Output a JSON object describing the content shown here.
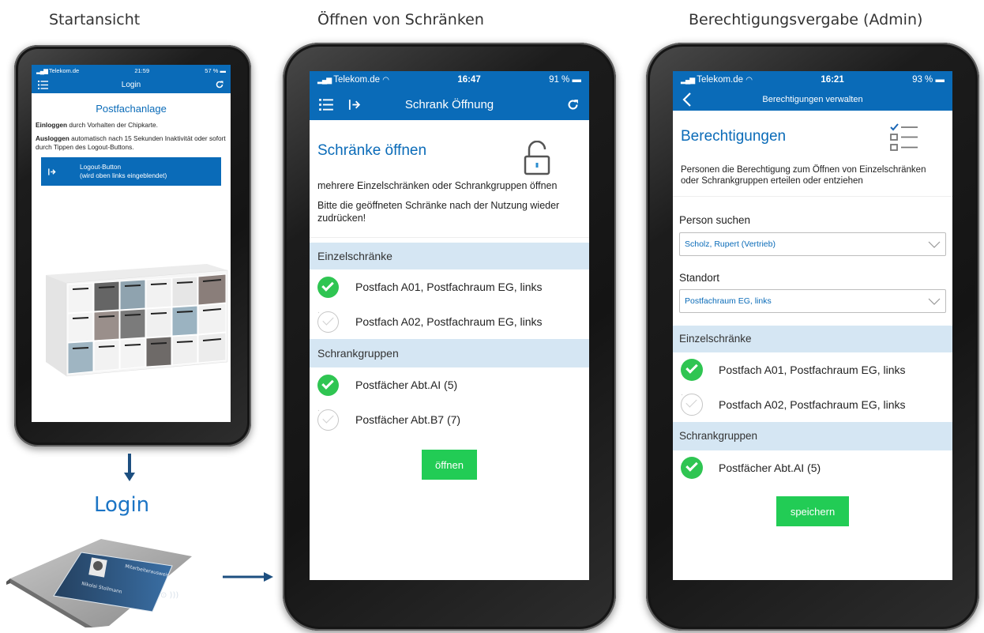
{
  "captions": {
    "start": "Startansicht",
    "open": "Öffnen von Schränken",
    "admin": "Berechtigungsvergabe (Admin)",
    "login": "Login"
  },
  "colors": {
    "brand_blue": "#0a6bb8",
    "section_bg": "#d5e6f3",
    "check_green": "#2fc552",
    "button_green": "#22cc55"
  },
  "screen1": {
    "status": {
      "carrier": "Telekom.de",
      "time": "21:59",
      "battery": "57 %"
    },
    "nav": {
      "title": "Login",
      "left_icon": "list-icon",
      "right_icon": "refresh-icon"
    },
    "heading": "Postfachanlage",
    "login_bold": "Einloggen",
    "login_text": " durch Vorhalten der Chipkarte.",
    "logout_bold": "Ausloggen",
    "logout_text": " automatisch nach 15 Sekunden Inaktivität oder sofort durch Tippen des Logout-Buttons.",
    "logout_button": {
      "line1": "Logout-Button",
      "line2": "(wird oben links eingeblendet)",
      "icon": "logout-icon"
    }
  },
  "card_reader": {
    "card_name": "Nikolai Stollmann",
    "card_brand": "Mitarbeiterausweis"
  },
  "screen2": {
    "status": {
      "carrier": "Telekom.de",
      "time": "16:47",
      "battery": "91 %"
    },
    "nav": {
      "title": "Schrank Öffnung",
      "left_icons": [
        "list-icon",
        "logout-icon"
      ],
      "right_icon": "refresh-icon"
    },
    "heading": "Schränke öffnen",
    "heading_icon": "unlock-icon",
    "text1": "mehrere Einzelschränken oder Schrankgruppen öffnen",
    "text2": "Bitte die geöffneten Schränke nach der Nutzung wieder zudrücken!",
    "sections": [
      {
        "header": "Einzelschränke",
        "items": [
          {
            "label": "Postfach A01, Postfachraum EG, links",
            "checked": true
          },
          {
            "label": "Postfach A02, Postfachraum EG, links",
            "checked": false
          }
        ]
      },
      {
        "header": "Schrankgruppen",
        "items": [
          {
            "label": "Postfächer Abt.AI (5)",
            "checked": true
          },
          {
            "label": "Postfächer Abt.B7 (7)",
            "checked": false
          }
        ]
      }
    ],
    "button": "öffnen"
  },
  "screen3": {
    "status": {
      "carrier": "Telekom.de",
      "time": "16:21",
      "battery": "93 %"
    },
    "nav": {
      "title": "Berechtigungen verwalten",
      "left_icon": "back-icon"
    },
    "heading": "Berechtigungen",
    "heading_icon": "checklist-icon",
    "description": "Personen die Berechtigung zum Öffnen von Einzelschränken oder Schrankgruppen erteilen oder entziehen",
    "person_label": "Person suchen",
    "person_value": "Scholz, Rupert (Vertrieb)",
    "location_label": "Standort",
    "location_value": "Postfachraum EG, links",
    "sections": [
      {
        "header": "Einzelschränke",
        "items": [
          {
            "label": "Postfach A01, Postfachraum EG, links",
            "checked": true
          },
          {
            "label": "Postfach A02, Postfachraum EG, links",
            "checked": false
          }
        ]
      },
      {
        "header": "Schrankgruppen",
        "items": [
          {
            "label": "Postfächer Abt.AI (5)",
            "checked": true
          }
        ]
      }
    ],
    "button": "speichern"
  }
}
